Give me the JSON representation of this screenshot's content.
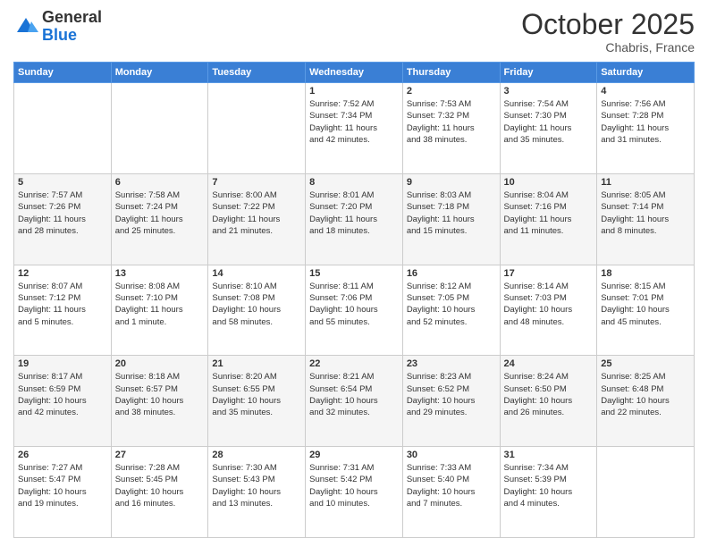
{
  "header": {
    "logo_line1": "General",
    "logo_line2": "Blue",
    "month": "October 2025",
    "location": "Chabris, France"
  },
  "days_of_week": [
    "Sunday",
    "Monday",
    "Tuesday",
    "Wednesday",
    "Thursday",
    "Friday",
    "Saturday"
  ],
  "weeks": [
    [
      {
        "day": "",
        "info": ""
      },
      {
        "day": "",
        "info": ""
      },
      {
        "day": "",
        "info": ""
      },
      {
        "day": "1",
        "info": "Sunrise: 7:52 AM\nSunset: 7:34 PM\nDaylight: 11 hours\nand 42 minutes."
      },
      {
        "day": "2",
        "info": "Sunrise: 7:53 AM\nSunset: 7:32 PM\nDaylight: 11 hours\nand 38 minutes."
      },
      {
        "day": "3",
        "info": "Sunrise: 7:54 AM\nSunset: 7:30 PM\nDaylight: 11 hours\nand 35 minutes."
      },
      {
        "day": "4",
        "info": "Sunrise: 7:56 AM\nSunset: 7:28 PM\nDaylight: 11 hours\nand 31 minutes."
      }
    ],
    [
      {
        "day": "5",
        "info": "Sunrise: 7:57 AM\nSunset: 7:26 PM\nDaylight: 11 hours\nand 28 minutes."
      },
      {
        "day": "6",
        "info": "Sunrise: 7:58 AM\nSunset: 7:24 PM\nDaylight: 11 hours\nand 25 minutes."
      },
      {
        "day": "7",
        "info": "Sunrise: 8:00 AM\nSunset: 7:22 PM\nDaylight: 11 hours\nand 21 minutes."
      },
      {
        "day": "8",
        "info": "Sunrise: 8:01 AM\nSunset: 7:20 PM\nDaylight: 11 hours\nand 18 minutes."
      },
      {
        "day": "9",
        "info": "Sunrise: 8:03 AM\nSunset: 7:18 PM\nDaylight: 11 hours\nand 15 minutes."
      },
      {
        "day": "10",
        "info": "Sunrise: 8:04 AM\nSunset: 7:16 PM\nDaylight: 11 hours\nand 11 minutes."
      },
      {
        "day": "11",
        "info": "Sunrise: 8:05 AM\nSunset: 7:14 PM\nDaylight: 11 hours\nand 8 minutes."
      }
    ],
    [
      {
        "day": "12",
        "info": "Sunrise: 8:07 AM\nSunset: 7:12 PM\nDaylight: 11 hours\nand 5 minutes."
      },
      {
        "day": "13",
        "info": "Sunrise: 8:08 AM\nSunset: 7:10 PM\nDaylight: 11 hours\nand 1 minute."
      },
      {
        "day": "14",
        "info": "Sunrise: 8:10 AM\nSunset: 7:08 PM\nDaylight: 10 hours\nand 58 minutes."
      },
      {
        "day": "15",
        "info": "Sunrise: 8:11 AM\nSunset: 7:06 PM\nDaylight: 10 hours\nand 55 minutes."
      },
      {
        "day": "16",
        "info": "Sunrise: 8:12 AM\nSunset: 7:05 PM\nDaylight: 10 hours\nand 52 minutes."
      },
      {
        "day": "17",
        "info": "Sunrise: 8:14 AM\nSunset: 7:03 PM\nDaylight: 10 hours\nand 48 minutes."
      },
      {
        "day": "18",
        "info": "Sunrise: 8:15 AM\nSunset: 7:01 PM\nDaylight: 10 hours\nand 45 minutes."
      }
    ],
    [
      {
        "day": "19",
        "info": "Sunrise: 8:17 AM\nSunset: 6:59 PM\nDaylight: 10 hours\nand 42 minutes."
      },
      {
        "day": "20",
        "info": "Sunrise: 8:18 AM\nSunset: 6:57 PM\nDaylight: 10 hours\nand 38 minutes."
      },
      {
        "day": "21",
        "info": "Sunrise: 8:20 AM\nSunset: 6:55 PM\nDaylight: 10 hours\nand 35 minutes."
      },
      {
        "day": "22",
        "info": "Sunrise: 8:21 AM\nSunset: 6:54 PM\nDaylight: 10 hours\nand 32 minutes."
      },
      {
        "day": "23",
        "info": "Sunrise: 8:23 AM\nSunset: 6:52 PM\nDaylight: 10 hours\nand 29 minutes."
      },
      {
        "day": "24",
        "info": "Sunrise: 8:24 AM\nSunset: 6:50 PM\nDaylight: 10 hours\nand 26 minutes."
      },
      {
        "day": "25",
        "info": "Sunrise: 8:25 AM\nSunset: 6:48 PM\nDaylight: 10 hours\nand 22 minutes."
      }
    ],
    [
      {
        "day": "26",
        "info": "Sunrise: 7:27 AM\nSunset: 5:47 PM\nDaylight: 10 hours\nand 19 minutes."
      },
      {
        "day": "27",
        "info": "Sunrise: 7:28 AM\nSunset: 5:45 PM\nDaylight: 10 hours\nand 16 minutes."
      },
      {
        "day": "28",
        "info": "Sunrise: 7:30 AM\nSunset: 5:43 PM\nDaylight: 10 hours\nand 13 minutes."
      },
      {
        "day": "29",
        "info": "Sunrise: 7:31 AM\nSunset: 5:42 PM\nDaylight: 10 hours\nand 10 minutes."
      },
      {
        "day": "30",
        "info": "Sunrise: 7:33 AM\nSunset: 5:40 PM\nDaylight: 10 hours\nand 7 minutes."
      },
      {
        "day": "31",
        "info": "Sunrise: 7:34 AM\nSunset: 5:39 PM\nDaylight: 10 hours\nand 4 minutes."
      },
      {
        "day": "",
        "info": ""
      }
    ]
  ]
}
